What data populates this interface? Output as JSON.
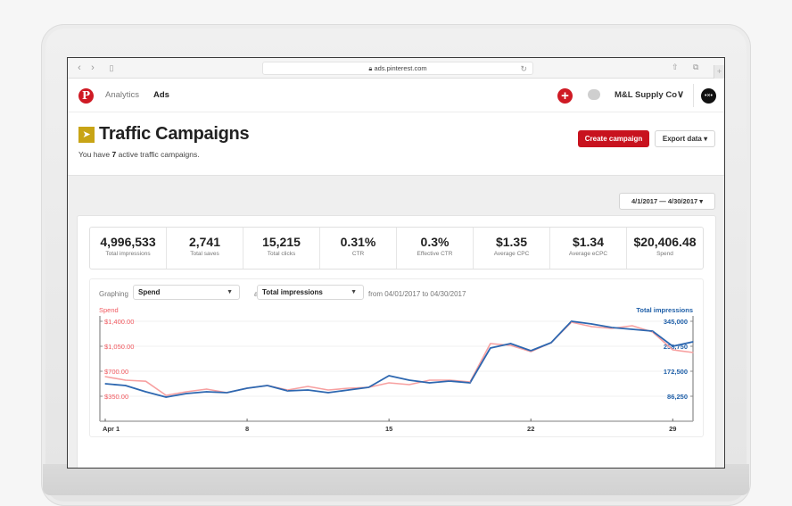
{
  "browser": {
    "url": "ads.pinterest.com",
    "back_icon": "‹",
    "forward_icon": "›"
  },
  "header": {
    "logo": "P",
    "nav": [
      {
        "label": "Analytics",
        "active": false
      },
      {
        "label": "Ads",
        "active": true
      }
    ],
    "account_name": "M&L Supply Co",
    "avatar_text": "•×•"
  },
  "page": {
    "title": "Traffic Campaigns",
    "subtitle_prefix": "You have ",
    "campaign_count": "7",
    "subtitle_suffix": " active traffic campaigns.",
    "create_button": "Create campaign",
    "export_button": "Export data ▾",
    "date_range": "4/1/2017 — 4/30/2017 ▾"
  },
  "stats": [
    {
      "value": "4,996,533",
      "label": "Total impressions"
    },
    {
      "value": "2,741",
      "label": "Total saves"
    },
    {
      "value": "15,215",
      "label": "Total clicks"
    },
    {
      "value": "0.31%",
      "label": "CTR"
    },
    {
      "value": "0.3%",
      "label": "Effective CTR"
    },
    {
      "value": "$1.35",
      "label": "Average CPC"
    },
    {
      "value": "$1.34",
      "label": "Average eCPC"
    },
    {
      "value": "$20,406.48",
      "label": "Spend"
    }
  ],
  "graph_controls": {
    "graphing_label": "Graphing",
    "metric1": "Spend",
    "and_label": "and",
    "metric2": "Total impressions",
    "range_text": "from 04/01/2017 to 04/30/2017"
  },
  "colors": {
    "brand_red": "#cf1a24",
    "spend_line": "#f7a0a0",
    "impressions_line": "#2d67b0"
  },
  "chart_data": {
    "type": "line",
    "title": "",
    "x": [
      1,
      2,
      3,
      4,
      5,
      6,
      7,
      8,
      9,
      10,
      11,
      12,
      13,
      14,
      15,
      16,
      17,
      18,
      19,
      20,
      21,
      22,
      23,
      24,
      25,
      26,
      27,
      28,
      29,
      30
    ],
    "x_tick_labels": [
      {
        "day": 1,
        "label": "Apr 1"
      },
      {
        "day": 8,
        "label": "8"
      },
      {
        "day": 15,
        "label": "15"
      },
      {
        "day": 22,
        "label": "22"
      },
      {
        "day": 29,
        "label": "29"
      }
    ],
    "xlabel": "",
    "series": [
      {
        "name": "Spend",
        "axis": "left",
        "values": [
          625,
          575,
          560,
          362,
          412,
          450,
          400,
          462,
          500,
          437,
          487,
          437,
          462,
          475,
          537,
          512,
          575,
          575,
          550,
          1087,
          1062,
          975,
          1100,
          1387,
          1325,
          1300,
          1337,
          1250,
          1000,
          962
        ]
      },
      {
        "name": "Total impressions",
        "axis": "right",
        "values": [
          129375,
          123200,
          101650,
          83170,
          95490,
          101650,
          98570,
          114000,
          123200,
          104730,
          107800,
          98570,
          107800,
          117000,
          157100,
          141700,
          132450,
          138620,
          132450,
          252590,
          268000,
          243350,
          271070,
          345000,
          335800,
          323440,
          317280,
          311120,
          258750,
          274150
        ]
      }
    ],
    "left_axis": {
      "title": "Spend",
      "ticks": [
        "$350.00",
        "$700.00",
        "$1,050.00",
        "$1,400.00"
      ],
      "tick_values": [
        350,
        700,
        1050,
        1400
      ],
      "range": [
        0,
        1400
      ]
    },
    "right_axis": {
      "title": "Total impressions",
      "ticks": [
        "86,250",
        "172,500",
        "258,750",
        "345,000"
      ],
      "tick_values": [
        86250,
        172500,
        258750,
        345000
      ],
      "range": [
        0,
        345000
      ]
    },
    "grid": true,
    "legend": "axis-titles"
  }
}
